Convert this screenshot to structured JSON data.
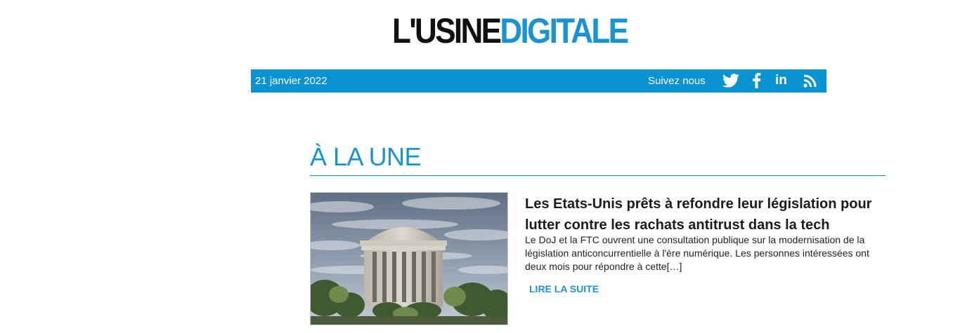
{
  "header": {
    "logo_part1": "L'USINE",
    "logo_part2": "DIGITALE",
    "logo_dark_color": "#111111",
    "logo_accent_color": "#1a93d1"
  },
  "topbar": {
    "date": "21 janvier 2022",
    "follow_label": "Suivez nous",
    "background_color": "#0a93d1",
    "social": [
      {
        "icon": "twitter-icon"
      },
      {
        "icon": "facebook-icon"
      },
      {
        "icon": "linkedin-icon",
        "text": "in"
      },
      {
        "icon": "rss-icon"
      }
    ]
  },
  "section": {
    "title": "À LA UNE"
  },
  "article": {
    "title": "Les Etats-Unis prêts à refondre leur législation pour lutter contre les rachats antitrust dans la tech",
    "summary": "Le DoJ et la FTC ouvrent une consultation publique sur la modernisation de la législation anticoncurrentielle à l'ère numérique. Les personnes intéressées ont deux mois pour répondre à cette[…]",
    "read_more": "LIRE LA SUITE",
    "image": "ftc-building-photo"
  }
}
